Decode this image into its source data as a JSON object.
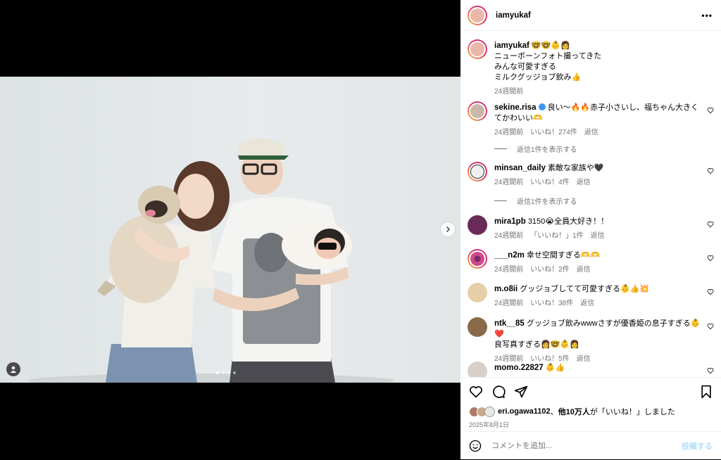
{
  "post": {
    "username": "iamyukaf",
    "more_label": "•••"
  },
  "caption": {
    "username": "iamyukaf",
    "emojis": "🤓🤓👶👩",
    "lines": [
      "ニューボーンフォト撮ってきた",
      "みんな可愛すぎる",
      "ミルクグッジョブ飲み👍"
    ],
    "time": "24週間前"
  },
  "comments": [
    {
      "user": "sekine.risa",
      "verified": true,
      "text": "良い〜🔥🔥赤子小さいし、福ちゃん大きくてかわいい🫶",
      "time": "24週間前",
      "likes": "いいね！274件",
      "reply": "返信",
      "more_replies": "返信1件を表示する",
      "avatar_color": "#c9b8a8"
    },
    {
      "user": "minsan_daily",
      "text": "素敵な家族や🖤",
      "time": "24週間前",
      "likes": "いいね！4件",
      "reply": "返信",
      "more_replies": "返信1件を表示する",
      "avatar_color": "#f5f5f5"
    },
    {
      "user": "mira1pb",
      "text": "3150😭全員大好き！！",
      "time": "24週間前",
      "likes": "「いいね！」1件",
      "reply": "返信",
      "avatar_color": "#6a2a58"
    },
    {
      "user": "___n2m",
      "text": "幸せ空間すぎる🫶🫶",
      "time": "24週間前",
      "likes": "いいね！2件",
      "reply": "返信",
      "avatar_color": "#d04a8a"
    },
    {
      "user": "m.o8ii",
      "text": "グッジョブしてて可愛すぎる👶👍💥",
      "time": "24週間前",
      "likes": "いいね！38件",
      "reply": "返信",
      "avatar_color": "#e6cfa6"
    },
    {
      "user": "ntk__85",
      "text": "グッジョブ飲みwwwさすが優香姫の息子すぎる👶❤️",
      "text2": "良写真すぎる👩🤓👶👩",
      "time": "24週間前",
      "likes": "いいね！5件",
      "reply": "返信",
      "avatar_color": "#8a6a4a"
    },
    {
      "user": "momo.22827",
      "text": "👶👍",
      "avatar_color": "#d8d0c8"
    }
  ],
  "actions": {
    "liked_by_user": "eri.ogawa1102",
    "liked_count": "他10万人",
    "liked_suffix": "が「いいね！」しました",
    "date": "2025年8月1日"
  },
  "composer": {
    "placeholder": "コメントを追加...",
    "post_label": "投稿する"
  },
  "carousel": {
    "dots": 4,
    "active": 0
  }
}
